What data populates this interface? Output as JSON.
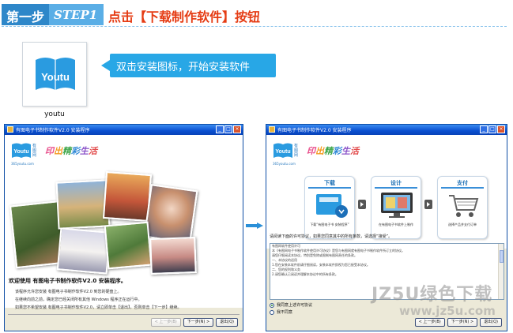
{
  "header": {
    "step_cn": "第一步",
    "step_en": "STEP1",
    "title": "点击【下载制作软件】按钮"
  },
  "app": {
    "icon_text": "Youtu",
    "label": "youtu"
  },
  "callout": {
    "text": "双击安装图标，开始安装软件"
  },
  "colors": {
    "accent": "#28a7e6",
    "title_red": "#e53c14",
    "xp_blue": "#0a4fd0"
  },
  "left_window": {
    "title": "有图电子书制作软件V2.0 安装程序",
    "brand_icon_text": "Youtu",
    "brand_side": "有图网",
    "slogan": [
      "印",
      "出",
      "精",
      "彩",
      "生",
      "活"
    ],
    "brand_url": "365youtu.com",
    "welcome_title": "欢迎使用 有图电子书制作软件V2.0 安装程序。",
    "welcome_lines": [
      "该程序允许您安装 有图电子书制作软件V2.0 到您的硬盘上。",
      "在继续向前之前，确定您已经关闭所有其他 Windows 程序正在运行中。",
      "如果您不希望安装 有图电子书制作软件V2.0，请立即单击【退出】，否则单击【下一步】继续。"
    ],
    "buttons": {
      "back": "< 上一步(B)",
      "next": "下一步(N) >",
      "exit": "退出(Q)"
    }
  },
  "right_window": {
    "title": "有图电子书制作软件V2.0 安装程序",
    "brand_icon_text": "Youtu",
    "brand_side": "有图网",
    "slogan": [
      "印",
      "出",
      "精",
      "彩",
      "生",
      "活"
    ],
    "brand_url": "365youtu.com",
    "steps": [
      {
        "title": "下载",
        "caption": "下载“有图电子书 安装程序”"
      },
      {
        "title": "设计",
        "caption": "在有图电子书软件上制作"
      },
      {
        "title": "支付",
        "caption": "选择产品并支付订单"
      }
    ],
    "license_prompt": "请阅读下面的许可协议，如果您同意其中的所有条款，请选择“接受”。",
    "license_lines": [
      "有图网软件使用许可",
      "本《有图网电子书制作软件使用许可协议》是您与有图网就有图电子书制作软件所订立的协议。",
      "请您仔细阅读本协议，特别是免除或限制有图网责任的条款。",
      "一、本协议的适用",
      "1.您在安装本软件前请仔细阅读，安装本软件即视为您已接受本协议。",
      "二、您的权利和义务",
      "2.请您确认已阅读并理解本协议中的所有条款。"
    ],
    "radios": [
      {
        "label": "我同意上述许可协议",
        "checked": true
      },
      {
        "label": "我不同意",
        "checked": false
      }
    ],
    "buttons": {
      "back": "< 上一步(B)",
      "next": "下一步(N) >",
      "exit": "退出(Q)"
    }
  },
  "watermark": {
    "brand": "JZ5U绿色下载",
    "url": "www.jz5u.com"
  }
}
